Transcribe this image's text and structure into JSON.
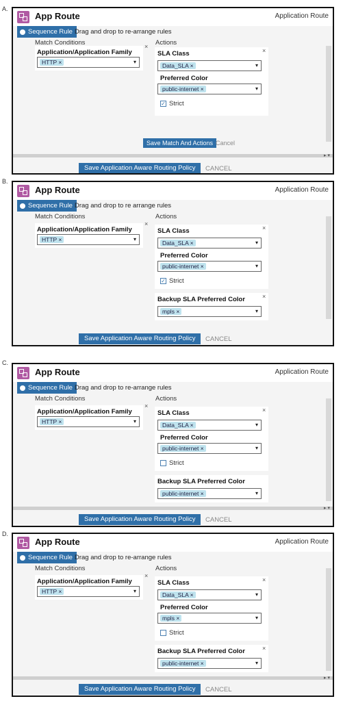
{
  "common": {
    "app_title": "App Route",
    "app_right": "Application Route",
    "sequence_rule": "Sequence Rule",
    "drag_text": "Drag and drop to re-arrange rules",
    "drag_text_alt": "Drag and drop to re arrange rules",
    "match_conditions": "Match Conditions",
    "actions": "Actions",
    "match_label": "Application/Application Family List",
    "match_chip": "HTTP",
    "sla_class_label": "SLA Class",
    "sla_chip": "Data_SLA",
    "preferred_color_label": "Preferred Color",
    "strict": "Strict",
    "backup_label": "Backup SLA Preferred Color",
    "save_policy": "Save Application Aware Routing Policy",
    "cancel_upper": "CANCEL",
    "save_match": "Save Match And Actions",
    "cancel": "Cancel",
    "close_glyph": "×",
    "chevron": "▾",
    "check": "✓"
  },
  "options": [
    {
      "letter": "A.",
      "preferred_color": "public-internet",
      "strict_checked": true,
      "backup": null
    },
    {
      "letter": "B.",
      "preferred_color": "public-internet",
      "strict_checked": true,
      "backup": "mpls"
    },
    {
      "letter": "C.",
      "preferred_color": "public-internet",
      "strict_checked": false,
      "backup": "public-internet"
    },
    {
      "letter": "D.",
      "preferred_color": "mpls",
      "strict_checked": false,
      "backup": "public-internet"
    }
  ]
}
